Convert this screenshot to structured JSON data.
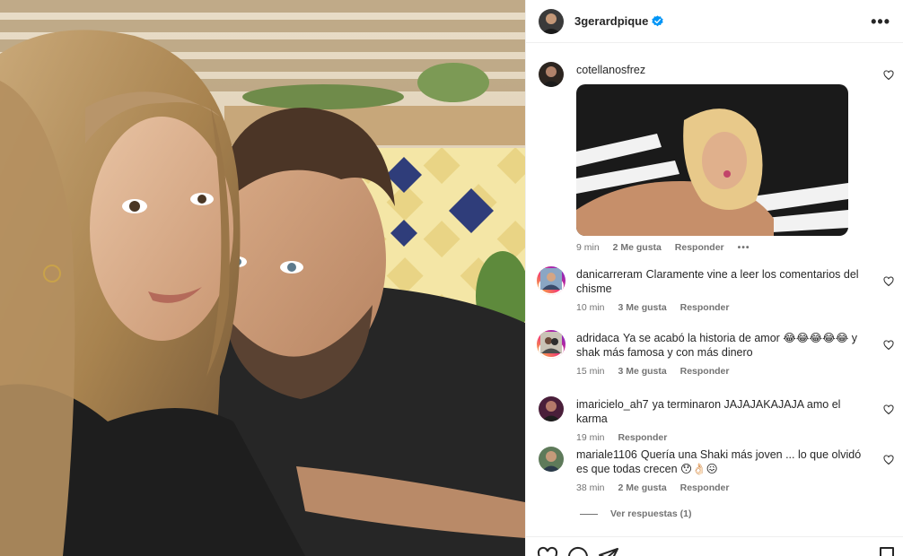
{
  "post": {
    "username": "3gerardpique",
    "verified": true,
    "more_label": "•••"
  },
  "comments": [
    {
      "username": "cotellanosfrez",
      "text": "",
      "has_gif": true,
      "time": "9 min",
      "likes": "2 Me gusta",
      "reply": "Responder",
      "options": "•••"
    },
    {
      "username": "danicarreram",
      "text": "Claramente vine a leer los comentarios del chisme",
      "time": "10 min",
      "likes": "3 Me gusta",
      "reply": "Responder"
    },
    {
      "username": "adridaca",
      "text": "Ya se acabó la historia de amor 😂😂😂😂😂 y shak más famosa y con más dinero",
      "time": "15 min",
      "likes": "3 Me gusta",
      "reply": "Responder"
    },
    {
      "username": "imaricielo_ah7",
      "text": "ya terminaron JAJAJAKAJAJA amo el karma",
      "time": "19 min",
      "likes": "",
      "reply": "Responder"
    },
    {
      "username": "mariale1106",
      "text": "Quería una Shaki más joven ... lo que olvidó es que todas crecen 😯👌🏻😖",
      "time": "38 min",
      "likes": "2 Me gusta",
      "reply": "Responder"
    }
  ],
  "view_replies": "Ver respuestas (1)",
  "icons": {
    "verified": "verified-badge-icon",
    "heart": "heart-outline-icon",
    "comment": "comment-icon",
    "share": "share-icon",
    "save": "bookmark-icon"
  },
  "colors": {
    "verified": "#0095f6",
    "text": "#262626",
    "secondary": "#737373",
    "divider": "#efefef"
  }
}
